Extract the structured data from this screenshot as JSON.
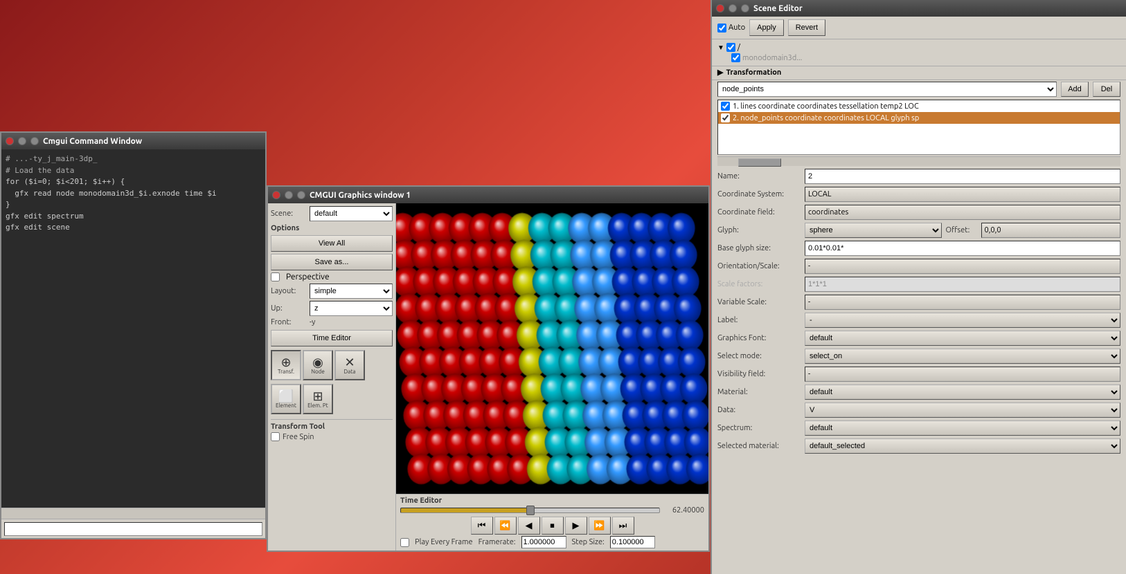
{
  "cmd_window": {
    "title": "Cmgui Command Window",
    "lines": [
      {
        "text": "# ...-ty_j_main-3dp_",
        "class": "comment"
      },
      {
        "text": "# Load the data",
        "class": "comment"
      },
      {
        "text": "for ($i=0; $i<201; $i++) {",
        "class": ""
      },
      {
        "text": "  gfx read node monodomain3d_$i.exnode time $i",
        "class": ""
      },
      {
        "text": "}",
        "class": ""
      },
      {
        "text": "gfx edit spectrum",
        "class": ""
      },
      {
        "text": "gfx edit scene",
        "class": ""
      }
    ],
    "input_placeholder": ""
  },
  "gfx_window": {
    "title": "CMGUI Graphics window 1",
    "scene_label": "Scene:",
    "scene_value": "default",
    "options_label": "Options",
    "view_all_label": "View All",
    "save_as_label": "Save as...",
    "perspective_label": "Perspective",
    "layout_label": "Layout:",
    "layout_value": "simple",
    "up_label": "Up:",
    "up_value": "z",
    "front_label": "Front:",
    "front_value": "-y",
    "time_editor_btn": "Time Editor",
    "tools": [
      {
        "label": "Transf.",
        "icon": "⊕"
      },
      {
        "label": "Node",
        "icon": "◉"
      },
      {
        "label": "Data",
        "icon": "✕"
      }
    ],
    "tools2": [
      {
        "label": "Element",
        "icon": "⬜"
      },
      {
        "label": "Elem. Pt",
        "icon": "⊞"
      }
    ],
    "transform_tool_label": "Transform Tool",
    "free_spin_label": "Free Spin",
    "time_editor": {
      "label": "Time Editor",
      "slider_pct": 50,
      "time_value": "62.40000",
      "transport_btns": [
        "⏮",
        "⏪",
        "◀",
        "⏹",
        "▶",
        "⏩",
        "⏭"
      ],
      "play_every_frame": "Play Every Frame",
      "framerate_label": "Framerate:",
      "framerate_value": "1.000000",
      "step_size_label": "Step Size:",
      "step_size_value": "0.100000"
    }
  },
  "scene_editor": {
    "title": "Scene Editor",
    "auto_label": "Auto",
    "apply_label": "Apply",
    "revert_label": "Revert",
    "tree": {
      "root": "/",
      "child": "monodomain3d..."
    },
    "transformation_label": "Transformation",
    "dropdown_label": "node_points",
    "add_label": "Add",
    "del_label": "Del",
    "list_items": [
      {
        "id": 1,
        "text": "1. lines coordinate coordinates tessellation temp2 LOC",
        "selected": false,
        "checked": true
      },
      {
        "id": 2,
        "text": "2. node_points coordinate coordinates LOCAL glyph sp",
        "selected": true,
        "checked": true
      }
    ],
    "props": {
      "name_label": "Name:",
      "name_value": "2",
      "coord_system_label": "Coordinate System:",
      "coord_system_value": "LOCAL",
      "coord_field_label": "Coordinate field:",
      "coord_field_value": "coordinates",
      "glyph_label": "Glyph:",
      "glyph_value": "sphere",
      "offset_label": "Offset:",
      "offset_value": "0,0,0",
      "base_glyph_size_label": "Base glyph size:",
      "base_glyph_size_value": "0.01*0.01*",
      "orientation_scale_label": "Orientation/Scale:",
      "orientation_scale_value": "-",
      "scale_factors_label": "Scale factors:",
      "scale_factors_value": "1*1*1",
      "variable_scale_label": "Variable Scale:",
      "variable_scale_value": "-",
      "label_label": "Label:",
      "label_value": "-",
      "graphics_font_label": "Graphics Font:",
      "graphics_font_value": "default",
      "select_mode_label": "Select mode:",
      "select_mode_value": "select_on",
      "visibility_field_label": "Visibility field:",
      "visibility_field_value": "-",
      "material_label": "Material:",
      "material_value": "default",
      "data_label": "Data:",
      "data_value": "V",
      "spectrum_label": "Spectrum:",
      "spectrum_value": "default",
      "selected_material_label": "Selected material:",
      "selected_material_value": "default_selected"
    }
  }
}
